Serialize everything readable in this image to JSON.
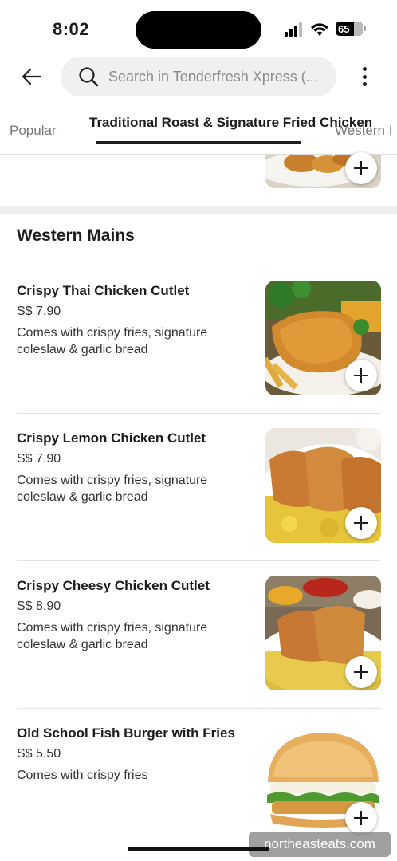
{
  "status_bar": {
    "time": "8:02",
    "battery": "65"
  },
  "search": {
    "placeholder": "Search in Tenderfresh Xpress (..."
  },
  "tabs": [
    {
      "label": "Popular"
    },
    {
      "label": "Traditional Roast & Signature Fried Chicken",
      "active": true
    },
    {
      "label": "Western I"
    }
  ],
  "section": {
    "title": "Western Mains"
  },
  "items": [
    {
      "name": "Crispy Thai Chicken Cutlet",
      "price": "S$ 7.90",
      "description": "Comes with crispy fries, signature coleslaw & garlic bread"
    },
    {
      "name": "Crispy Lemon Chicken Cutlet",
      "price": "S$ 7.90",
      "description": "Comes with crispy fries, signature coleslaw & garlic bread"
    },
    {
      "name": "Crispy Cheesy Chicken Cutlet",
      "price": "S$ 8.90",
      "description": "Comes with crispy fries, signature coleslaw & garlic bread"
    },
    {
      "name": "Old School Fish Burger with Fries",
      "price": "S$ 5.50",
      "description": "Comes with crispy fries"
    }
  ],
  "watermark": "northeasteats.com",
  "colors": {
    "text": "#1c1c1c",
    "muted": "#777777",
    "search_bg": "#f0f0f0",
    "divider": "#e2e2e2"
  }
}
